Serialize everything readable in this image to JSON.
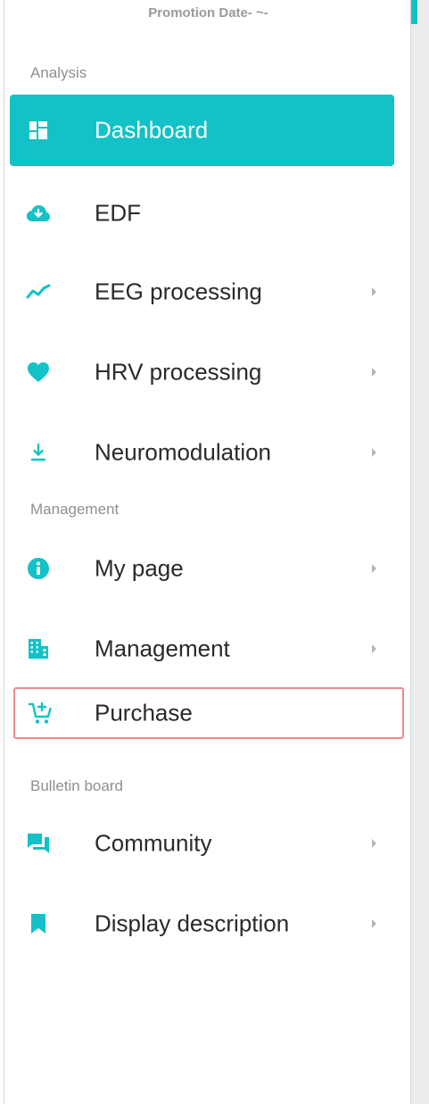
{
  "promo_text": "Promotion Date- ~-",
  "sections": {
    "analysis": "Analysis",
    "management": "Management",
    "bulletin": "Bulletin board"
  },
  "nav": {
    "dashboard": "Dashboard",
    "edf": "EDF",
    "eeg": "EEG processing",
    "hrv": "HRV processing",
    "neuro": "Neuromodulation",
    "mypage": "My page",
    "management": "Management",
    "purchase": "Purchase",
    "community": "Community",
    "display": "Display description"
  },
  "icons": {
    "dashboard": "dashboard-icon",
    "edf": "cloud-download-icon",
    "eeg": "line-chart-icon",
    "hrv": "heart-icon",
    "neuro": "download-arrow-icon",
    "mypage": "info-icon",
    "management": "building-icon",
    "purchase": "add-to-cart-icon",
    "community": "chat-icon",
    "display": "bookmark-icon"
  },
  "colors": {
    "accent": "#12c2c6",
    "active_text": "#ffffff",
    "selected_outline": "#ef8a8e"
  },
  "state": {
    "active_item": "Dashboard",
    "outlined_item": "Purchase"
  }
}
